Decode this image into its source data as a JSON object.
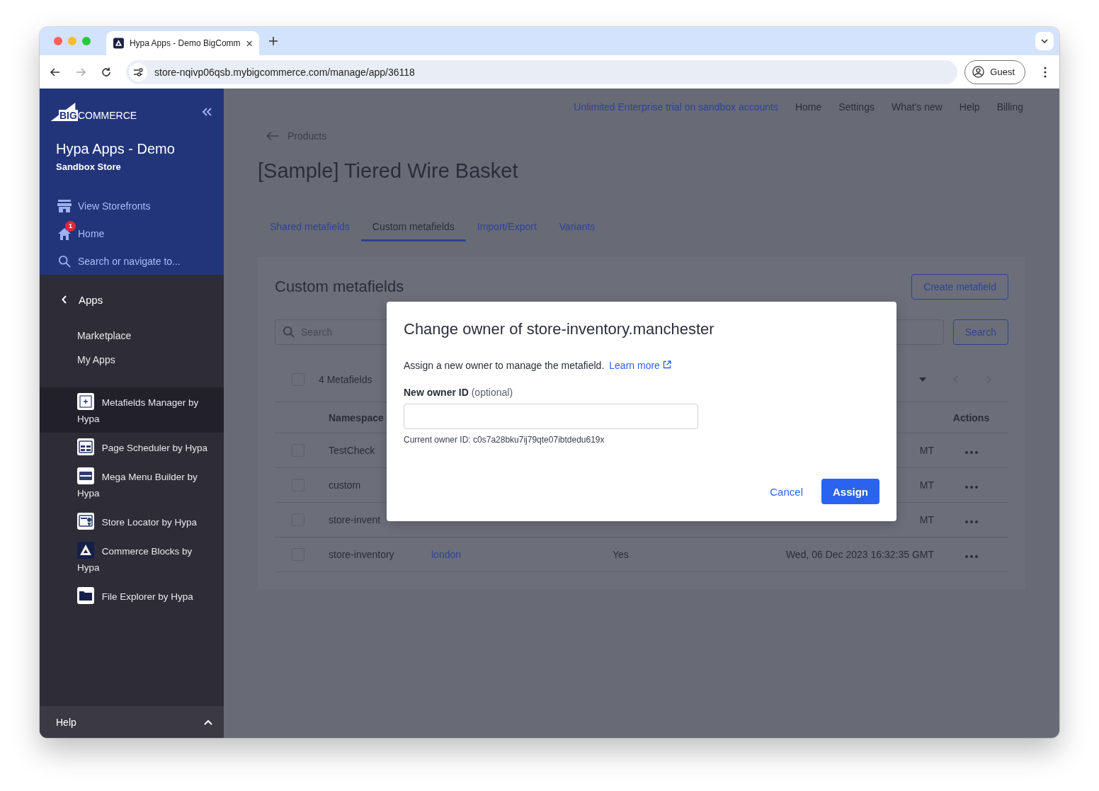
{
  "browser": {
    "tab": {
      "title": "Hypa Apps - Demo BigComm",
      "selected": true
    },
    "url": "store-nqivp06qsb.mybigcommerce.com/manage/app/36118",
    "profile": "Guest"
  },
  "sidebar": {
    "logo": {
      "prefix": "BIG",
      "name": "COMMERCE"
    },
    "store_name": "Hypa Apps - Demo",
    "store_type": "Sandbox Store",
    "nav": [
      {
        "kind": "storefront",
        "label": "View Storefronts"
      },
      {
        "kind": "home",
        "label": "Home",
        "badge": "1"
      },
      {
        "kind": "search",
        "label": "Search or navigate to..."
      }
    ],
    "section": "Apps",
    "links": [
      "Marketplace",
      "My Apps"
    ],
    "apps": [
      {
        "kind": "metafields",
        "label": "Metafields Manager by Hypa",
        "selected": true
      },
      {
        "kind": "scheduler",
        "label": "Page Scheduler by Hypa",
        "selected": false
      },
      {
        "kind": "menu",
        "label": "Mega Menu Builder by Hypa",
        "selected": false
      },
      {
        "kind": "locator",
        "label": "Store Locator by Hypa",
        "selected": false
      },
      {
        "kind": "blocks",
        "label": "Commerce Blocks by Hypa",
        "selected": false
      },
      {
        "kind": "files",
        "label": "File Explorer by Hypa",
        "selected": false
      }
    ],
    "help": "Help"
  },
  "top_nav": {
    "trial": "Unlimited Enterprise trial on sandbox accounts",
    "links": [
      "Home",
      "Settings",
      "What's new",
      "Help",
      "Billing"
    ]
  },
  "breadcrumb": "Products",
  "title": "[Sample] Tiered Wire Basket",
  "tabs": [
    {
      "label": "Shared metafields",
      "selected": false
    },
    {
      "label": "Custom metafields",
      "selected": true
    },
    {
      "label": "Import/Export",
      "selected": false
    },
    {
      "label": "Variants",
      "selected": false
    }
  ],
  "card": {
    "title": "Custom metafields",
    "create_button": "Create metafield",
    "search": {
      "placeholder": "Search"
    },
    "search_button": "Search",
    "count": "4 Metafields",
    "all_checked": false,
    "columns": {
      "namespace": "Namespace",
      "actions": "Actions"
    },
    "rows": [
      {
        "checked": false,
        "namespace": "TestCheck",
        "column_5": "MT"
      },
      {
        "checked": false,
        "namespace": "custom",
        "column_5": "MT"
      },
      {
        "checked": false,
        "namespace": "store-invent",
        "column_5": "MT"
      },
      {
        "checked": false,
        "namespace": "store-inventory",
        "column_3": "london",
        "column_4": "Yes",
        "column_5": "Wed, 06 Dec 2023 16:32:35 GMT"
      }
    ]
  },
  "modal": {
    "title": "Change owner of store-inventory.manchester",
    "description": "Assign a new owner to manage the metafield.",
    "learn_more": "Learn more",
    "field_label": "New owner ID",
    "field_hint": "(optional)",
    "current_owner": "Current owner ID: c0s7a28bku7ij79qte07ibtdedu619x",
    "cancel": "Cancel",
    "assign": "Assign"
  }
}
